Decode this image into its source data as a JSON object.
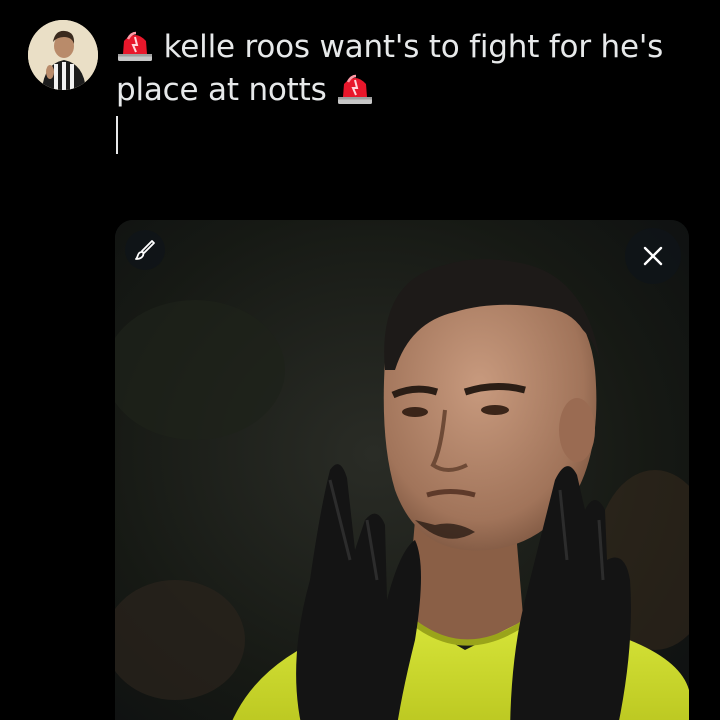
{
  "composer": {
    "line1": "kelle roos want's to fight for he's",
    "line2": "place at notts"
  },
  "icons": {
    "siren": "police-car-light-emoji",
    "edit": "pencil-brush-icon",
    "close": "close-icon"
  },
  "colors": {
    "background": "#000000",
    "text": "#e7e9ea",
    "media_button_bg": "#0f1419"
  }
}
